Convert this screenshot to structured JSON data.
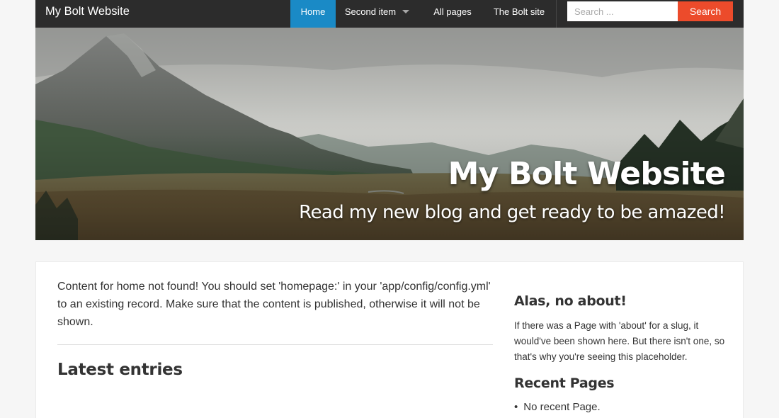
{
  "navbar": {
    "brand": "My Bolt Website",
    "items": [
      {
        "label": "Home",
        "active": true
      },
      {
        "label": "Second item",
        "has_dropdown": true
      },
      {
        "label": "All pages"
      },
      {
        "label": "The Bolt site"
      }
    ],
    "search": {
      "placeholder": "Search ...",
      "button_label": "Search"
    }
  },
  "hero": {
    "title": "My Bolt Website",
    "subtitle": "Read my new blog and get ready to be amazed!"
  },
  "main": {
    "notice": "Content for home not found! You should set 'homepage:' in your 'app/config/config.yml' to an existing record. Make sure that the content is published, otherwise it will not be shown.",
    "latest_heading": "Latest entries"
  },
  "sidebar": {
    "about_heading": "Alas, no about!",
    "about_text": "If there was a Page with 'about' for a slug, it would've been shown here. But there isn't one, so that's why you're seeing this placeholder.",
    "recent_heading": "Recent Pages",
    "recent_items": [
      "No recent Page."
    ]
  },
  "colors": {
    "navbar_bg": "#2c2c2c",
    "nav_active_bg": "#1a8ac6",
    "search_button_bg": "#ec4b2b",
    "page_bg": "#f6f6f6"
  }
}
